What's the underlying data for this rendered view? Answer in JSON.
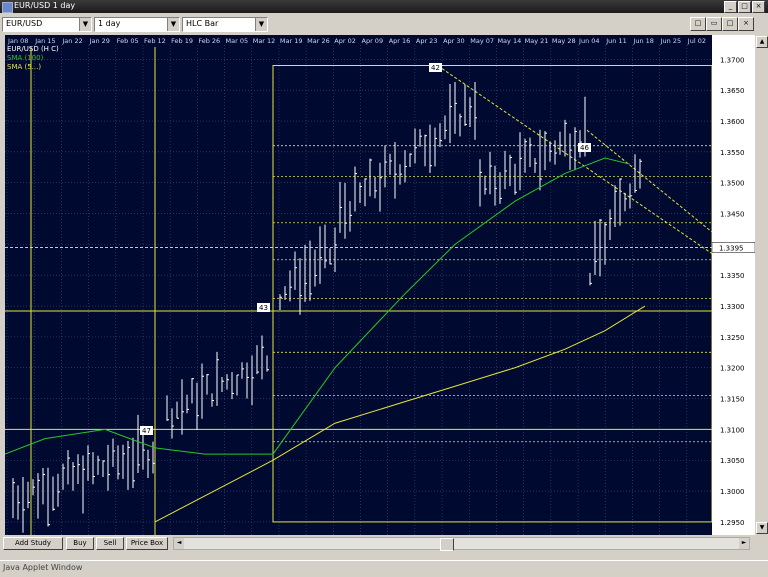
{
  "window": {
    "title": "EUR/USD 1 day",
    "btn_min": "_",
    "btn_max": "□",
    "btn_close": "×"
  },
  "toolbar": {
    "symbol": "EUR/USD",
    "interval": "1 day",
    "chart_style": "HLC Bar",
    "corner_btns": [
      "□",
      "▭",
      "□",
      "×"
    ]
  },
  "chart_window": {
    "dates": [
      "Jan 08",
      "Jan 15",
      "Jan 22",
      "Jan 29",
      "Feb 05",
      "Feb 12",
      "Feb 19",
      "Feb 26",
      "Mar 05",
      "Mar 12",
      "Mar 19",
      "Mar 26",
      "Apr 02",
      "Apr 09",
      "Apr 16",
      "Apr 23",
      "Apr 30",
      "May 07",
      "May 14",
      "May 21",
      "May 28",
      "Jun 04",
      "Jun 11",
      "Jun 18",
      "Jun 25",
      "Jul 02"
    ],
    "legend": [
      "EUR/USD (H C)",
      "SMA (100)",
      "SMA (5...)"
    ],
    "current_price": "1.3395",
    "annotations": [
      "42",
      "43",
      "46",
      "47"
    ]
  },
  "bottom": {
    "add_study": "Add Study",
    "buy": "Buy",
    "sell": "Sell",
    "price_box": "Price Box",
    "arrow_left": "◄",
    "arrow_right": "►",
    "arrow_up": "▲",
    "arrow_down": "▼"
  },
  "status": {
    "text": "Java Applet Window"
  },
  "colors": {
    "background": "#000a30",
    "grid": "#3c4a80",
    "bars": "#ffffff",
    "sma_fast": "#28c628",
    "sma_slow": "#e4e43c",
    "fib": "#e4e43c"
  },
  "chart_data": {
    "type": "bar",
    "title": "EUR/USD",
    "x_labels": [
      "Jan 08",
      "Jan 15",
      "Jan 22",
      "Jan 29",
      "Feb 05",
      "Feb 12",
      "Feb 19",
      "Feb 26",
      "Mar 05",
      "Mar 12",
      "Mar 19",
      "Mar 26",
      "Apr 02",
      "Apr 09",
      "Apr 16",
      "Apr 23",
      "Apr 30",
      "May 07",
      "May 14",
      "May 21",
      "May 28",
      "Jun 04",
      "Jun 11",
      "Jun 18",
      "Jun 25",
      "Jul 02"
    ],
    "y_ticks": [
      1.295,
      1.3,
      1.305,
      1.31,
      1.315,
      1.32,
      1.325,
      1.33,
      1.335,
      1.34,
      1.345,
      1.35,
      1.355,
      1.36,
      1.365,
      1.37
    ],
    "ylim": [
      1.2945,
      1.372
    ],
    "grid": true,
    "current_price": 1.3395,
    "ohlc_close_series": [
      1.3,
      1.305,
      1.298,
      1.297,
      1.302,
      1.307,
      1.311,
      1.315,
      1.312,
      1.318,
      1.323,
      1.329,
      1.334,
      1.333,
      1.335,
      1.338,
      1.34,
      1.344,
      1.35,
      1.356,
      1.36,
      1.364,
      1.362,
      1.357,
      1.354,
      1.352,
      1.347,
      1.346,
      1.344,
      1.35,
      1.345,
      1.342,
      1.34,
      1.346,
      1.349,
      1.339,
      1.331,
      1.336,
      1.3395
    ],
    "sma_slow": [
      1.295,
      1.299,
      1.303,
      1.307,
      1.311,
      1.315,
      1.318,
      1.32,
      1.322,
      1.324,
      1.327,
      1.33,
      1.335
    ],
    "sma_fast": [
      1.305,
      1.309,
      1.306,
      1.306,
      1.31,
      1.318,
      1.326,
      1.333,
      1.34,
      1.345,
      1.349,
      1.353,
      1.352
    ]
  }
}
